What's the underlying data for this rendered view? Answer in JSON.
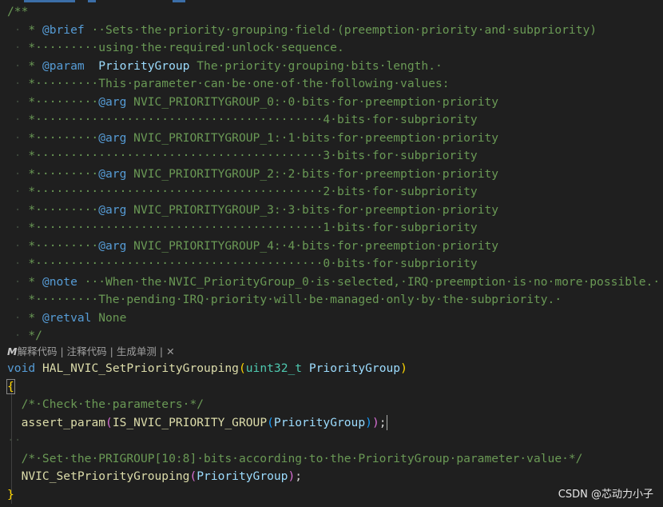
{
  "editor": {
    "lines": [
      [
        {
          "t": "/**",
          "c": "cm"
        }
      ],
      [
        {
          "t": " · ",
          "c": "ws"
        },
        {
          "t": "* ",
          "c": "cm"
        },
        {
          "t": "@brief",
          "c": "tag"
        },
        {
          "t": " ··Sets·the·priority·grouping·field·(preemption·priority·and·subpriority)",
          "c": "cm"
        }
      ],
      [
        {
          "t": " · ",
          "c": "ws"
        },
        {
          "t": "*·········",
          "c": "cm"
        },
        {
          "t": "using·the·required·unlock·sequence.",
          "c": "cm"
        }
      ],
      [
        {
          "t": " · ",
          "c": "ws"
        },
        {
          "t": "* ",
          "c": "cm"
        },
        {
          "t": "@param",
          "c": "tag"
        },
        {
          "t": "  ",
          "c": "cm"
        },
        {
          "t": "PriorityGroup",
          "c": "pname"
        },
        {
          "t": " The·priority·grouping·bits·length.·",
          "c": "cm"
        }
      ],
      [
        {
          "t": " · ",
          "c": "ws"
        },
        {
          "t": "*·········",
          "c": "cm"
        },
        {
          "t": "This·parameter·can·be·one·of·the·following·values:",
          "c": "cm"
        }
      ],
      [
        {
          "t": " · ",
          "c": "ws"
        },
        {
          "t": "*·········",
          "c": "cm"
        },
        {
          "t": "@arg",
          "c": "tag"
        },
        {
          "t": " NVIC_PRIORITYGROUP_0:·0·bits·for·preemption·priority",
          "c": "cm"
        }
      ],
      [
        {
          "t": " · ",
          "c": "ws"
        },
        {
          "t": "*·········································4·bits·for·subpriority",
          "c": "cm"
        }
      ],
      [
        {
          "t": " · ",
          "c": "ws"
        },
        {
          "t": "*·········",
          "c": "cm"
        },
        {
          "t": "@arg",
          "c": "tag"
        },
        {
          "t": " NVIC_PRIORITYGROUP_1:·1·bits·for·preemption·priority",
          "c": "cm"
        }
      ],
      [
        {
          "t": " · ",
          "c": "ws"
        },
        {
          "t": "*·········································3·bits·for·subpriority",
          "c": "cm"
        }
      ],
      [
        {
          "t": " · ",
          "c": "ws"
        },
        {
          "t": "*·········",
          "c": "cm"
        },
        {
          "t": "@arg",
          "c": "tag"
        },
        {
          "t": " NVIC_PRIORITYGROUP_2:·2·bits·for·preemption·priority",
          "c": "cm"
        }
      ],
      [
        {
          "t": " · ",
          "c": "ws"
        },
        {
          "t": "*·········································2·bits·for·subpriority",
          "c": "cm"
        }
      ],
      [
        {
          "t": " · ",
          "c": "ws"
        },
        {
          "t": "*·········",
          "c": "cm"
        },
        {
          "t": "@arg",
          "c": "tag"
        },
        {
          "t": " NVIC_PRIORITYGROUP_3:·3·bits·for·preemption·priority",
          "c": "cm"
        }
      ],
      [
        {
          "t": " · ",
          "c": "ws"
        },
        {
          "t": "*·········································1·bits·for·subpriority",
          "c": "cm"
        }
      ],
      [
        {
          "t": " · ",
          "c": "ws"
        },
        {
          "t": "*·········",
          "c": "cm"
        },
        {
          "t": "@arg",
          "c": "tag"
        },
        {
          "t": " NVIC_PRIORITYGROUP_4:·4·bits·for·preemption·priority",
          "c": "cm"
        }
      ],
      [
        {
          "t": " · ",
          "c": "ws"
        },
        {
          "t": "*·········································0·bits·for·subpriority",
          "c": "cm"
        }
      ],
      [
        {
          "t": " · ",
          "c": "ws"
        },
        {
          "t": "* ",
          "c": "cm"
        },
        {
          "t": "@note",
          "c": "tag"
        },
        {
          "t": " ···When·the·NVIC_PriorityGroup_0·is·selected,·IRQ·preemption·is·no·more·possible.·",
          "c": "cm"
        }
      ],
      [
        {
          "t": " · ",
          "c": "ws"
        },
        {
          "t": "*·········",
          "c": "cm"
        },
        {
          "t": "The·pending·IRQ·priority·will·be·managed·only·by·the·subpriority.·",
          "c": "cm"
        }
      ],
      [
        {
          "t": " · ",
          "c": "ws"
        },
        {
          "t": "* ",
          "c": "cm"
        },
        {
          "t": "@retval",
          "c": "tag"
        },
        {
          "t": " None",
          "c": "cm"
        }
      ],
      [
        {
          "t": " · ",
          "c": "ws"
        },
        {
          "t": "*/",
          "c": "cm"
        }
      ]
    ],
    "code": [
      [
        {
          "t": "void",
          "c": "kw"
        },
        {
          "t": " ",
          "c": "pu"
        },
        {
          "t": "HAL_NVIC_SetPriorityGrouping",
          "c": "fn"
        },
        {
          "t": "(",
          "c": "p1"
        },
        {
          "t": "uint32_t",
          "c": "ty"
        },
        {
          "t": " ",
          "c": "pu"
        },
        {
          "t": "PriorityGroup",
          "c": "id"
        },
        {
          "t": ")",
          "c": "p1"
        }
      ],
      [
        {
          "t": "{",
          "c": "p1"
        }
      ],
      [
        {
          "t": "  ",
          "c": "ws"
        },
        {
          "t": "/*·Check·the·parameters·*/",
          "c": "cm"
        }
      ],
      [
        {
          "t": "  ",
          "c": "ws"
        },
        {
          "t": "assert_param",
          "c": "fn"
        },
        {
          "t": "(",
          "c": "p2"
        },
        {
          "t": "IS_NVIC_PRIORITY_GROUP",
          "c": "fn"
        },
        {
          "t": "(",
          "c": "p3"
        },
        {
          "t": "PriorityGroup",
          "c": "id"
        },
        {
          "t": ")",
          "c": "p3"
        },
        {
          "t": ")",
          "c": "p2"
        },
        {
          "t": ";",
          "c": "pu"
        }
      ],
      [
        {
          "t": "··",
          "c": "ws"
        }
      ],
      [
        {
          "t": "  ",
          "c": "ws"
        },
        {
          "t": "/*·Set·the·PRIGROUP[10:8]·bits·according·to·the·PriorityGroup·parameter·value·*/",
          "c": "cm"
        }
      ],
      [
        {
          "t": "  ",
          "c": "ws"
        },
        {
          "t": "NVIC_SetPriorityGrouping",
          "c": "fn"
        },
        {
          "t": "(",
          "c": "p2"
        },
        {
          "t": "PriorityGroup",
          "c": "id"
        },
        {
          "t": ")",
          "c": "p2"
        },
        {
          "t": ";",
          "c": "pu"
        }
      ],
      [
        {
          "t": "}",
          "c": "p1"
        }
      ]
    ]
  },
  "codelens": {
    "logo": "M",
    "explain": "解释代码",
    "comment": "注释代码",
    "unittest": "生成单测",
    "sep": "|",
    "close": "✕"
  },
  "watermark": "CSDN @芯动力小子"
}
